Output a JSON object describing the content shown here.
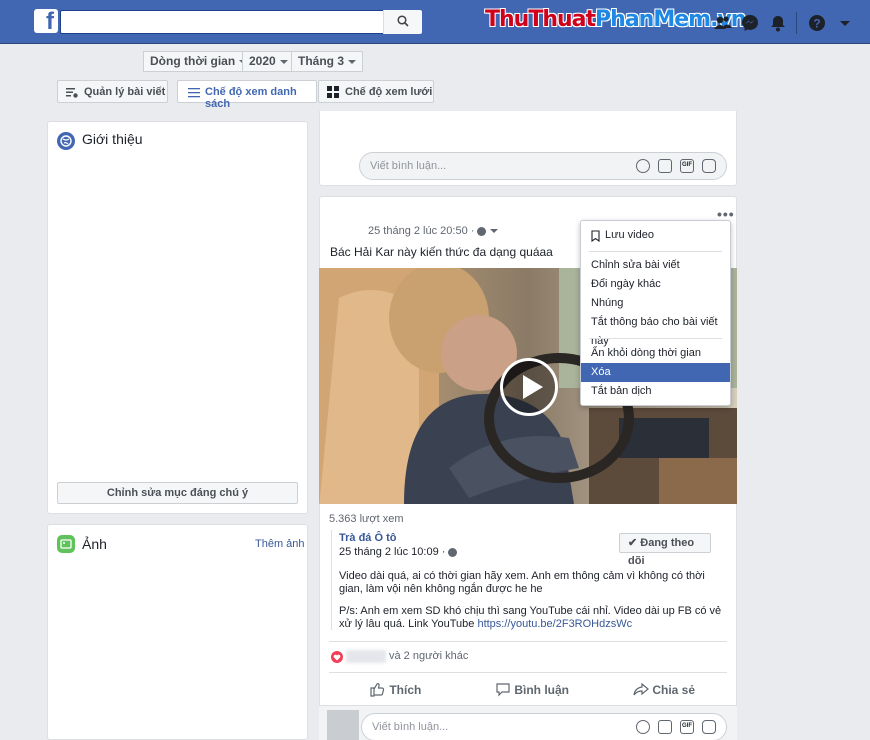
{
  "topbar": {
    "logo": "f",
    "search_placeholder": "",
    "brand_part1": "ThuThuat",
    "brand_part2": "PhanMem",
    "brand_part3": ".vn",
    "icons": [
      "friends-icon",
      "messenger-icon",
      "notifications-icon",
      "help-icon",
      "chevron-down-icon"
    ]
  },
  "filters": {
    "timeline": "Dòng thời gian",
    "year": "2020",
    "month": "Tháng 3"
  },
  "toolbar": {
    "manage_posts": "Quản lý bài viết",
    "list_view": "Chế độ xem danh sách",
    "grid_view": "Chế độ xem lưới"
  },
  "intro": {
    "title": "Giới thiệu",
    "edit_featured": "Chỉnh sửa mục đáng chú ý"
  },
  "photos": {
    "title": "Ảnh",
    "add_photos": "Thêm ảnh"
  },
  "comment_placeholder": "Viết bình luận...",
  "post": {
    "timestamp": "25 tháng 2 lúc 20:50 ·",
    "caption": "Bác Hải Kar này kiến thức đa dạng quáaa",
    "views": "5.363 lượt xem",
    "source_name": "Trà đá Ô tô",
    "source_time": "25 tháng 2 lúc 10:09 ·",
    "following": "Đang theo dõi",
    "desc1": "Video dài quá, ai có thời gian hãy xem. Anh em thông cảm vì không có thời gian, làm vội nên không ngắn được he he",
    "desc2": "P/s: Anh em xem SD khó chịu thì sang YouTube cái nhỉ. Video dài up FB có vẻ xử lý lâu quá. Link YouTube ",
    "desc_link": "https://youtu.be/2F3ROHdzsWc",
    "reactions": "và 2 người khác",
    "like": "Thích",
    "comment": "Bình luận",
    "share": "Chia sẻ"
  },
  "menu": {
    "save_video": "Lưu video",
    "edit_post": "Chỉnh sửa bài viết",
    "change_date": "Đổi ngày khác",
    "embed": "Nhúng",
    "mute_notifications": "Tắt thông báo cho bài viết này",
    "hide_timeline": "Ẩn khỏi dòng thời gian",
    "delete": "Xóa",
    "disable_translation": "Tắt bản dịch"
  },
  "colors": {
    "topbar": "#4267b2",
    "active_menu": "#4267b2",
    "link": "#385898",
    "brand_red": "#d0021b",
    "brand_blue": "#1e88e5"
  }
}
